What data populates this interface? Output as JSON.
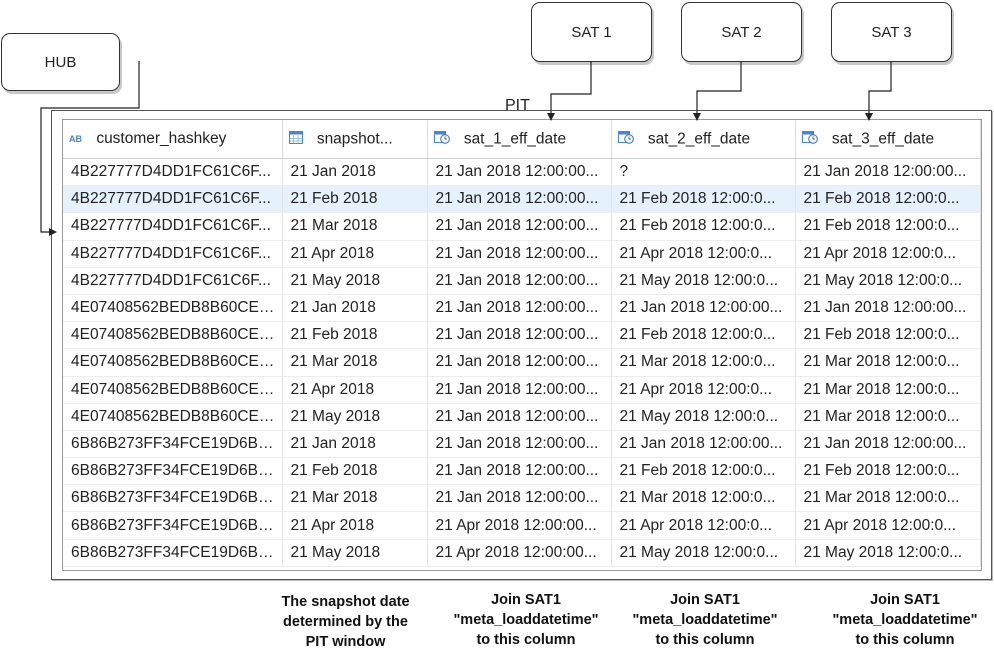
{
  "hub": {
    "label": "HUB"
  },
  "satellites": [
    {
      "label": "SAT 1"
    },
    {
      "label": "SAT 2"
    },
    {
      "label": "SAT 3"
    }
  ],
  "pit": {
    "label": "PIT"
  },
  "table": {
    "columns": [
      {
        "label": "customer_hashkey",
        "icon": "text-type-icon",
        "icon_text": "AB"
      },
      {
        "label": "snapshot...",
        "icon": "calendar-icon"
      },
      {
        "label": "sat_1_eff_date",
        "icon": "datetime-icon"
      },
      {
        "label": "sat_2_eff_date",
        "icon": "datetime-icon"
      },
      {
        "label": "sat_3_eff_date",
        "icon": "datetime-icon"
      }
    ],
    "selected_row": 1,
    "rows": [
      [
        "4B227777D4DD1FC61C6F...",
        "21 Jan 2018",
        "21 Jan 2018 12:00:00...",
        "?",
        "21 Jan 2018 12:00:00..."
      ],
      [
        "4B227777D4DD1FC61C6F...",
        "21 Feb 2018",
        "21 Jan 2018 12:00:00...",
        "21 Feb 2018 12:00:0...",
        "21 Feb 2018 12:00:0..."
      ],
      [
        "4B227777D4DD1FC61C6F...",
        "21 Mar 2018",
        "21 Jan 2018 12:00:00...",
        "21 Feb 2018 12:00:0...",
        "21 Feb 2018 12:00:0..."
      ],
      [
        "4B227777D4DD1FC61C6F...",
        "21 Apr 2018",
        "21 Jan 2018 12:00:00...",
        "21 Apr 2018 12:00:0...",
        "21 Apr 2018 12:00:0..."
      ],
      [
        "4B227777D4DD1FC61C6F...",
        "21 May 2018",
        "21 Jan 2018 12:00:00...",
        "21 May 2018 12:00:0...",
        "21 May 2018 12:00:0..."
      ],
      [
        "4E07408562BEDB8B60CE0...",
        "21 Jan 2018",
        "21 Jan 2018 12:00:00...",
        "21 Jan 2018 12:00:00...",
        "21 Jan 2018 12:00:00..."
      ],
      [
        "4E07408562BEDB8B60CE0...",
        "21 Feb 2018",
        "21 Jan 2018 12:00:00...",
        "21 Feb 2018 12:00:0...",
        "21 Feb 2018 12:00:0..."
      ],
      [
        "4E07408562BEDB8B60CE0...",
        "21 Mar 2018",
        "21 Jan 2018 12:00:00...",
        "21 Mar 2018 12:00:0...",
        "21 Mar 2018 12:00:0..."
      ],
      [
        "4E07408562BEDB8B60CE0...",
        "21 Apr 2018",
        "21 Jan 2018 12:00:00...",
        "21 Apr 2018 12:00:0...",
        "21 Mar 2018 12:00:0..."
      ],
      [
        "4E07408562BEDB8B60CE0...",
        "21 May 2018",
        "21 Jan 2018 12:00:00...",
        "21 May 2018 12:00:0...",
        "21 Mar 2018 12:00:0..."
      ],
      [
        "6B86B273FF34FCE19D6B8...",
        "21 Jan 2018",
        "21 Jan 2018 12:00:00...",
        "21 Jan 2018 12:00:00...",
        "21 Jan 2018 12:00:00..."
      ],
      [
        "6B86B273FF34FCE19D6B8...",
        "21 Feb 2018",
        "21 Jan 2018 12:00:00...",
        "21 Feb 2018 12:00:0...",
        "21 Feb 2018 12:00:0..."
      ],
      [
        "6B86B273FF34FCE19D6B8...",
        "21 Mar 2018",
        "21 Jan 2018 12:00:00...",
        "21 Mar 2018 12:00:0...",
        "21 Mar 2018 12:00:0..."
      ],
      [
        "6B86B273FF34FCE19D6B8...",
        "21 Apr 2018",
        "21 Apr 2018 12:00:00...",
        "21 Apr 2018 12:00:0...",
        "21 Apr 2018 12:00:0..."
      ],
      [
        "6B86B273FF34FCE19D6B8...",
        "21 May 2018",
        "21 Apr 2018 12:00:00...",
        "21 May 2018 12:00:0...",
        "21 May 2018 12:00:0..."
      ]
    ]
  },
  "notes": [
    {
      "lines": [
        "The snapshot date",
        "determined by the",
        "PIT window"
      ]
    },
    {
      "lines": [
        "Join SAT1",
        "\"meta_loaddatetime\"",
        "to this column"
      ]
    },
    {
      "lines": [
        "Join SAT1",
        "\"meta_loaddatetime\"",
        "to this column"
      ]
    },
    {
      "lines": [
        "Join SAT1",
        "\"meta_loaddatetime\"",
        "to this column"
      ]
    }
  ],
  "colors": {
    "selected_row_bg": "#e5f1fb",
    "icon_blue": "#4a86c7",
    "line": "#222222"
  }
}
